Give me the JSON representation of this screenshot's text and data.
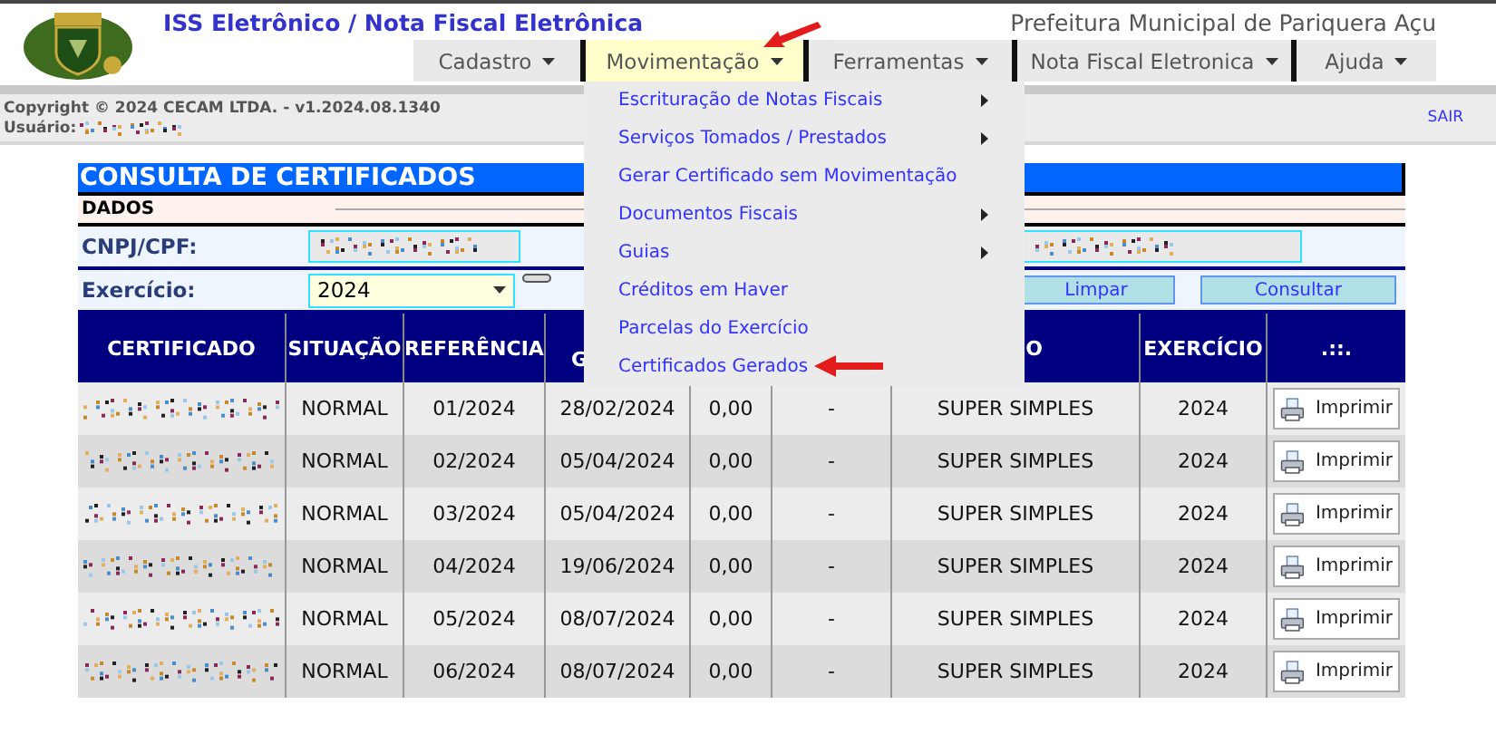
{
  "header": {
    "title": "ISS Eletrônico / Nota Fiscal Eletrônica",
    "municipality": "Prefeitura Municipal de Pariquera Açu"
  },
  "nav": [
    {
      "label": "Cadastro",
      "selected": false
    },
    {
      "label": "Movimentação",
      "selected": true
    },
    {
      "label": "Ferramentas",
      "selected": false
    },
    {
      "label": "Nota Fiscal Eletronica",
      "selected": false
    },
    {
      "label": "Ajuda",
      "selected": false
    }
  ],
  "open_menu": [
    {
      "label": "Escrituração de Notas Fiscais",
      "submenu": true
    },
    {
      "label": "Serviços Tomados / Prestados",
      "submenu": true
    },
    {
      "label": "Gerar Certificado sem Movimentação",
      "submenu": false
    },
    {
      "label": "Documentos Fiscais",
      "submenu": true
    },
    {
      "label": "Guias",
      "submenu": true
    },
    {
      "label": "Créditos em Haver",
      "submenu": false
    },
    {
      "label": "Parcelas do Exercício",
      "submenu": false
    },
    {
      "label": "Certificados Gerados",
      "submenu": false
    }
  ],
  "info_bar": {
    "copyright": "Copyright © 2024 CECAM LTDA. - v1.2024.08.1340",
    "user_label": "Usuário:",
    "logout": "SAIR"
  },
  "panel": {
    "title": "CONSULTA DE CERTIFICADOS",
    "section": "DADOS",
    "document_label": "CNPJ/CPF:",
    "year_label": "Exercício:",
    "year_value": "2024",
    "buttons": [
      "Limpar",
      "Consultar"
    ]
  },
  "table": {
    "columns": [
      "CERTIFICADO",
      "SITUAÇÃO",
      "REFERÊNCIA",
      "G",
      null,
      null,
      "O",
      "EXERCÍCIO",
      ".::."
    ],
    "rows": [
      {
        "status": "NORMAL",
        "reference": "01/2024",
        "date": "28/02/2024",
        "amount": "0,00",
        "column_6": "-",
        "regime": "SUPER SIMPLES",
        "year": "2024",
        "action": "Imprimir"
      },
      {
        "status": "NORMAL",
        "reference": "02/2024",
        "date": "05/04/2024",
        "amount": "0,00",
        "column_6": "-",
        "regime": "SUPER SIMPLES",
        "year": "2024",
        "action": "Imprimir"
      },
      {
        "status": "NORMAL",
        "reference": "03/2024",
        "date": "05/04/2024",
        "amount": "0,00",
        "column_6": "-",
        "regime": "SUPER SIMPLES",
        "year": "2024",
        "action": "Imprimir"
      },
      {
        "status": "NORMAL",
        "reference": "04/2024",
        "date": "19/06/2024",
        "amount": "0,00",
        "column_6": "-",
        "regime": "SUPER SIMPLES",
        "year": "2024",
        "action": "Imprimir"
      },
      {
        "status": "NORMAL",
        "reference": "05/2024",
        "date": "08/07/2024",
        "amount": "0,00",
        "column_6": "-",
        "regime": "SUPER SIMPLES",
        "year": "2024",
        "action": "Imprimir"
      },
      {
        "status": "NORMAL",
        "reference": "06/2024",
        "date": "08/07/2024",
        "amount": "0,00",
        "column_6": "-",
        "regime": "SUPER SIMPLES",
        "year": "2024",
        "action": "Imprimir"
      }
    ]
  }
}
